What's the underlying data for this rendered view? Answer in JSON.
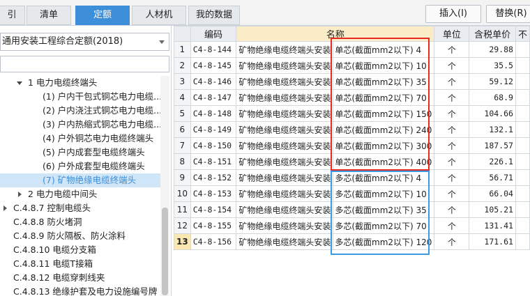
{
  "tabs": [
    {
      "label": "引"
    },
    {
      "label": "清单"
    },
    {
      "label": "定额"
    },
    {
      "label": "人材机"
    },
    {
      "label": "我的数据"
    }
  ],
  "active_tab": "定额",
  "toolbar": {
    "insert_label": "插入(I)",
    "replace_label": "替换(R)"
  },
  "library": {
    "selected": "通用安装工程综合定额(2018)",
    "search_value": ""
  },
  "tree": [
    {
      "label": "1 电力电缆终端头"
    },
    {
      "label": "(1) 户内干包式铜芯电力电缆..."
    },
    {
      "label": "(2) 户内浇注式铜芯电力电缆..."
    },
    {
      "label": "(3) 户内热缩式铜芯电力电缆..."
    },
    {
      "label": "(4) 户外铜芯电力电缆终端头"
    },
    {
      "label": "(5) 户内成套型电缆终端头"
    },
    {
      "label": "(6) 户外成套型电缆终端头"
    },
    {
      "label": "(7) 矿物绝缘电缆终端头"
    },
    {
      "label": "2 电力电缆中间头"
    },
    {
      "label": "C.4.8.7 控制电缆头"
    },
    {
      "label": "C.4.8.8 防火堵洞"
    },
    {
      "label": "C.4.8.9 防火隔板、防火涂料"
    },
    {
      "label": "C.4.8.10 电缆分支箱"
    },
    {
      "label": "C.4.8.11 电缆T接箱"
    },
    {
      "label": "C.4.8.12 电缆穿刺线夹"
    },
    {
      "label": "C.4.8.13 绝缘护套及电力设施编号牌"
    }
  ],
  "grid": {
    "columns": {
      "code": "编码",
      "name": "名称",
      "unit": "单位",
      "price": "含税单价",
      "extra": "不"
    },
    "rows": [
      {
        "num": "1",
        "code": "C4-8-144",
        "name": "矿物绝缘电缆终端头安装",
        "spec": "单芯(截面mm2以下) 4",
        "unit": "个",
        "price": "29.88"
      },
      {
        "num": "2",
        "code": "C4-8-145",
        "name": "矿物绝缘电缆终端头安装",
        "spec": "单芯(截面mm2以下) 10",
        "unit": "个",
        "price": "35.5"
      },
      {
        "num": "3",
        "code": "C4-8-146",
        "name": "矿物绝缘电缆终端头安装",
        "spec": "单芯(截面mm2以下) 35",
        "unit": "个",
        "price": "59.12"
      },
      {
        "num": "4",
        "code": "C4-8-147",
        "name": "矿物绝缘电缆终端头安装",
        "spec": "单芯(截面mm2以下) 70",
        "unit": "个",
        "price": "68.9"
      },
      {
        "num": "5",
        "code": "C4-8-148",
        "name": "矿物绝缘电缆终端头安装",
        "spec": "单芯(截面mm2以下) 150",
        "unit": "个",
        "price": "104.66"
      },
      {
        "num": "6",
        "code": "C4-8-149",
        "name": "矿物绝缘电缆终端头安装",
        "spec": "单芯(截面mm2以下) 240",
        "unit": "个",
        "price": "132.1"
      },
      {
        "num": "7",
        "code": "C4-8-150",
        "name": "矿物绝缘电缆终端头安装",
        "spec": "单芯(截面mm2以下) 300",
        "unit": "个",
        "price": "187.57"
      },
      {
        "num": "8",
        "code": "C4-8-151",
        "name": "矿物绝缘电缆终端头安装",
        "spec": "单芯(截面mm2以下) 400",
        "unit": "个",
        "price": "226.1"
      },
      {
        "num": "9",
        "code": "C4-8-152",
        "name": "矿物绝缘电缆终端头安装",
        "spec": "多芯(截面mm2以下) 4",
        "unit": "个",
        "price": "56.71"
      },
      {
        "num": "10",
        "code": "C4-8-153",
        "name": "矿物绝缘电缆终端头安装",
        "spec": "多芯(截面mm2以下) 10",
        "unit": "个",
        "price": "66.04"
      },
      {
        "num": "11",
        "code": "C4-8-154",
        "name": "矿物绝缘电缆终端头安装",
        "spec": "多芯(截面mm2以下) 35",
        "unit": "个",
        "price": "105.21"
      },
      {
        "num": "12",
        "code": "C4-8-155",
        "name": "矿物绝缘电缆终端头安装",
        "spec": "多芯(截面mm2以下) 70",
        "unit": "个",
        "price": "131.41"
      },
      {
        "num": "13",
        "code": "C4-8-156",
        "name": "矿物绝缘电缆终端头安装",
        "spec": "多芯(截面mm2以下) 120",
        "unit": "个",
        "price": "171.61"
      }
    ],
    "current_row": "13"
  },
  "colors": {
    "accent": "#3d8fd9",
    "highlight_red": "#e52a22",
    "highlight_blue": "#3a9ae2",
    "selected_tree": "#cfe5f8"
  }
}
